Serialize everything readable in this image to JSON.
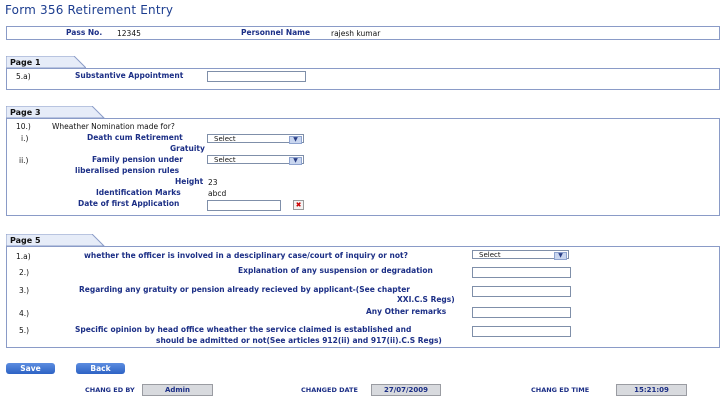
{
  "title": "Form 356 Retirement Entry",
  "header": {
    "pass_label": "Pass No.",
    "pass_value": "12345",
    "personnel_label": "Personnel Name",
    "personnel_value": "rajesh kumar"
  },
  "page1": {
    "tab": "Page 1",
    "row": {
      "num": "5.a)",
      "label": "Substantive Appointment",
      "value": ""
    }
  },
  "page3": {
    "tab": "Page 3",
    "q10": {
      "num": "10.)",
      "text": "Wheather Nomination made for?"
    },
    "q_i": {
      "num": "i.)",
      "label1": "Death cum Retirement",
      "label2": "Gratuity",
      "selected": "Select"
    },
    "q_ii": {
      "num": "ii.)",
      "label1": "Family pension under",
      "label2": "liberalised pension rules",
      "selected": "Select"
    },
    "height_label": "Height",
    "height_value": "23",
    "id_marks_label": "Identification Marks",
    "id_marks_value": "abcd",
    "first_app_label": "Date of first Application",
    "first_app_value": ""
  },
  "page5": {
    "tab": "Page 5",
    "rows": [
      {
        "num": "1.a)",
        "label": "whether the officer is involved in a desciplinary case/court of inquiry or not?",
        "selected": "Select"
      },
      {
        "num": "2.)",
        "label": "Explanation of any suspension or degradation",
        "value": ""
      },
      {
        "num": "3.)",
        "label1": "Regarding any gratuity or pension already recieved by applicant-(See chapter",
        "label2": "XXI.C.S Regs)",
        "value": ""
      },
      {
        "num": "4.)",
        "label": "Any Other remarks",
        "value": ""
      },
      {
        "num": "5.)",
        "label1": "Specific opinion by head office wheather the service claimed is established and",
        "label2": "should be admitted or not(See articles 912(ii) and 917(ii).C.S Regs)",
        "value": ""
      }
    ]
  },
  "buttons": {
    "save": "Save",
    "back": "Back"
  },
  "footer": {
    "changed_by_label": "CHANG ED BY",
    "changed_by_value": "Admin",
    "changed_date_label": "CHANGED DATE",
    "changed_date_value": "27/07/2009",
    "changed_time_label": "CHANG ED TIME",
    "changed_time_value": "15:21:09"
  },
  "icons": {
    "calendar": "calendar-icon",
    "dropdown": "chevron-down-icon"
  },
  "colors": {
    "label": "#1c2f86",
    "title": "#1c3d8f",
    "border": "#8a9bc7",
    "button": "#2d62c4"
  }
}
